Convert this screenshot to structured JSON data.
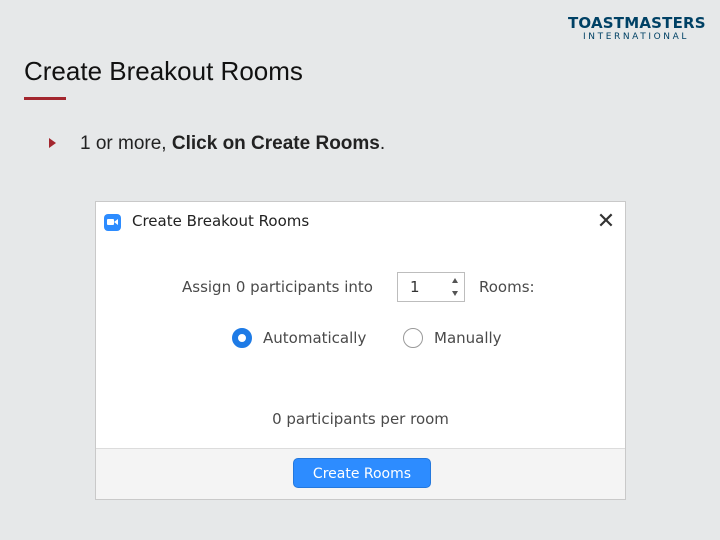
{
  "logo": {
    "main": "TOASTMASTERS",
    "sub": "INTERNATIONAL"
  },
  "slide": {
    "title": "Create Breakout Rooms",
    "bullet_prefix": "1 or more, ",
    "bullet_bold": "Click on Create Rooms",
    "bullet_suffix": "."
  },
  "dialog": {
    "title": "Create Breakout Rooms",
    "close_glyph": "✕",
    "assign_label": "Assign 0 participants into",
    "rooms_value": "1",
    "rooms_label": "Rooms:",
    "options": [
      {
        "label": "Automatically",
        "selected": true
      },
      {
        "label": "Manually",
        "selected": false
      }
    ],
    "per_room": "0 participants per room",
    "create_button": "Create Rooms"
  },
  "colors": {
    "accent": "#a3262e",
    "zoom_blue": "#2d8cff",
    "brand_navy": "#004165"
  },
  "icons": [
    "zoom-app-icon",
    "close-icon",
    "bullet-triangle-icon",
    "stepper-up-icon",
    "stepper-down-icon"
  ]
}
